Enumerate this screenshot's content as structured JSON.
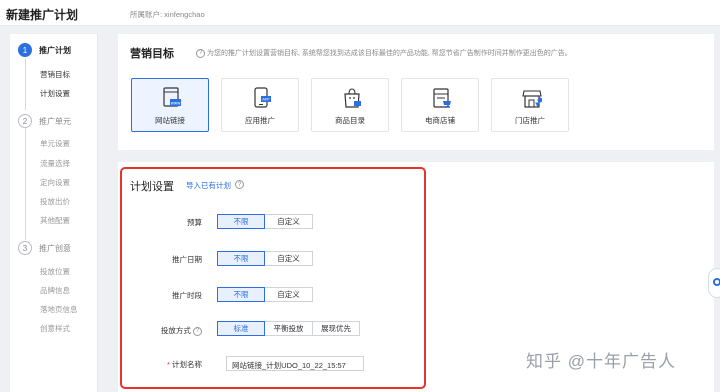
{
  "header": {
    "title": "新建推广计划",
    "account": "所属账户: xinfengchao"
  },
  "sidebar": {
    "steps": [
      {
        "num": "1",
        "label": "推广计划",
        "subs": [
          "营销目标",
          "计划设置"
        ]
      },
      {
        "num": "2",
        "label": "推广单元",
        "subs": [
          "单元设置",
          "流量选择",
          "定向设置",
          "投放出价",
          "其他配置"
        ]
      },
      {
        "num": "3",
        "label": "推广创意",
        "subs": [
          "投放位置",
          "品牌信息",
          "落地页信息",
          "创意样式"
        ]
      }
    ]
  },
  "goals": {
    "title": "营销目标",
    "desc": "为您的推广计划设置营销目标, 系统帮您找到达成该目标最佳的产品功能, 帮您节省广告制作时间并制作更出色的广告。",
    "items": [
      {
        "label": "网站链接",
        "badge": "www"
      },
      {
        "label": "应用推广",
        "badge": "APP"
      },
      {
        "label": "商品目录",
        "badge": ""
      },
      {
        "label": "电商店铺",
        "badge": ""
      },
      {
        "label": "门店推广",
        "badge": ""
      }
    ]
  },
  "plan": {
    "title": "计划设置",
    "import_link": "导入已有计划",
    "budget": {
      "label": "预算",
      "options": [
        "不限",
        "自定义"
      ]
    },
    "date": {
      "label": "推广日期",
      "options": [
        "不限",
        "自定义"
      ]
    },
    "time": {
      "label": "推广时段",
      "options": [
        "不限",
        "自定义"
      ]
    },
    "delivery": {
      "label": "投放方式",
      "options": [
        "标准",
        "平衡投放",
        "展现优先"
      ]
    },
    "name": {
      "label": "计划名称",
      "required_mark": "*",
      "value": "网站链接_计划UDO_10_22_15:57"
    }
  },
  "watermark": "知乎 @十年广告人",
  "colors": {
    "accent": "#2c6fe0",
    "highlight_box": "#e8332a"
  }
}
